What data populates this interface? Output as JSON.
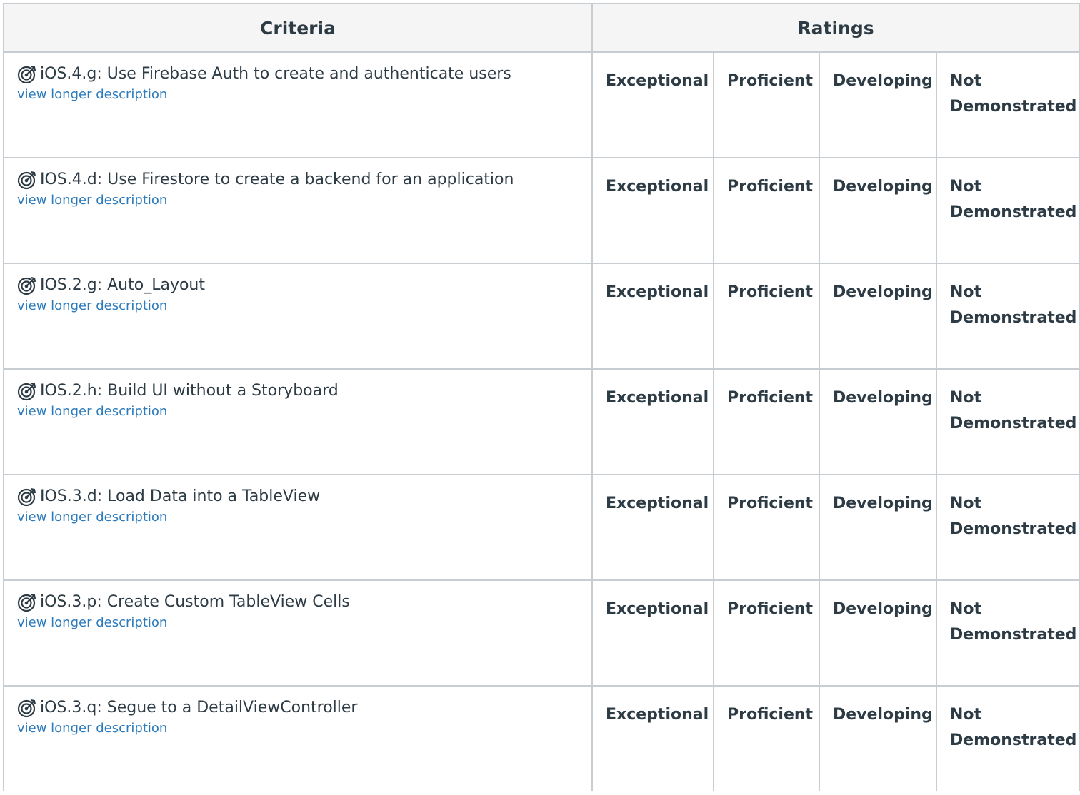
{
  "header": {
    "criteria_label": "Criteria",
    "ratings_label": "Ratings"
  },
  "icon": "outcome-target-icon",
  "link_color": "#2b7abc",
  "border_color": "#c7cdd1",
  "criteria": [
    {
      "title": "iOS.4.g: Use Firebase Auth to create and authenticate users",
      "link": "view longer description",
      "ratings": [
        "Exceptional",
        "Proficient",
        "Developing",
        "Not Demonstrated"
      ]
    },
    {
      "title": "IOS.4.d: Use Firestore to create a backend for an application",
      "link": "view longer description",
      "ratings": [
        "Exceptional",
        "Proficient",
        "Developing",
        "Not Demonstrated"
      ]
    },
    {
      "title": "IOS.2.g: Auto_Layout",
      "link": "view longer description",
      "ratings": [
        "Exceptional",
        "Proficient",
        "Developing",
        "Not Demonstrated"
      ]
    },
    {
      "title": "IOS.2.h: Build UI without a Storyboard",
      "link": "view longer description",
      "ratings": [
        "Exceptional",
        "Proficient",
        "Developing",
        "Not Demonstrated"
      ]
    },
    {
      "title": "IOS.3.d: Load Data into a TableView",
      "link": "view longer description",
      "ratings": [
        "Exceptional",
        "Proficient",
        "Developing",
        "Not Demonstrated"
      ]
    },
    {
      "title": "iOS.3.p: Create Custom TableView Cells",
      "link": "view longer description",
      "ratings": [
        "Exceptional",
        "Proficient",
        "Developing",
        "Not Demonstrated"
      ]
    },
    {
      "title": "iOS.3.q: Segue to a DetailViewController",
      "link": "view longer description",
      "ratings": [
        "Exceptional",
        "Proficient",
        "Developing",
        "Not Demonstrated"
      ]
    }
  ]
}
